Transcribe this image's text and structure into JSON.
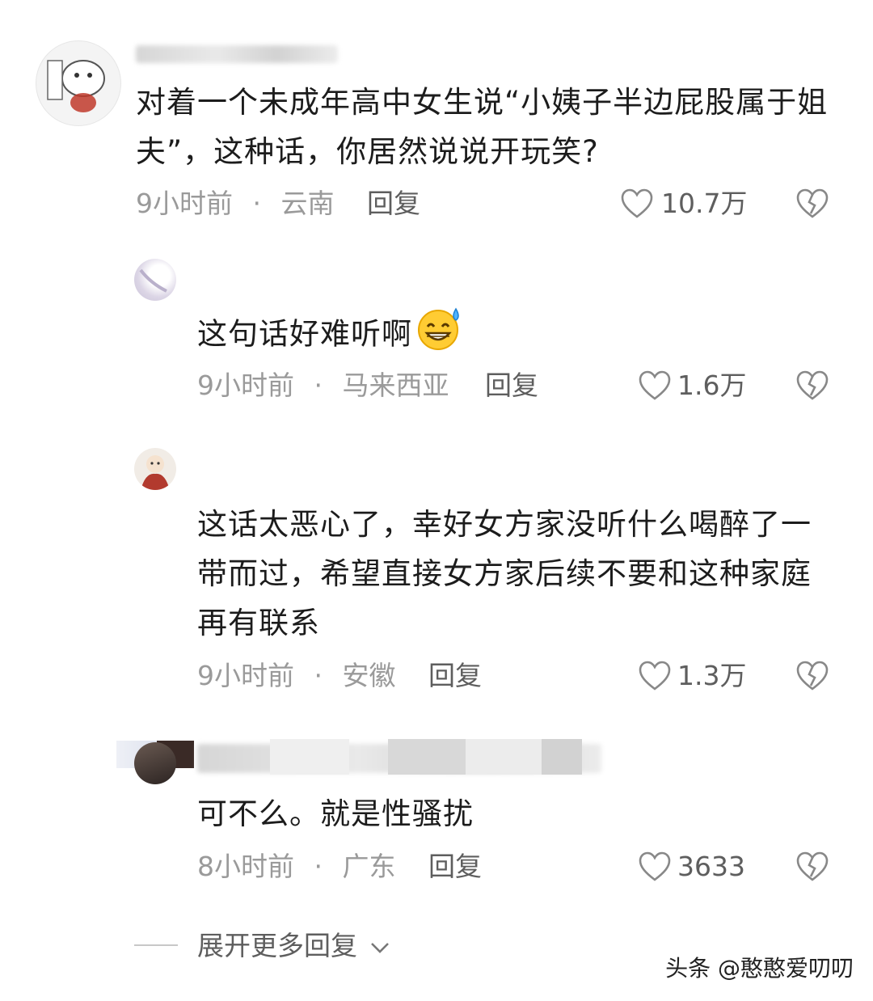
{
  "comments": [
    {
      "text": "对着一个未成年高中女生说“小姨子半边屁股属于姐夫”，这种话，你居然说说开玩笑?",
      "time": "9小时前",
      "location": "云南",
      "reply_label": "回复",
      "likes": "10.7万"
    },
    {
      "text": "这句话好难听啊",
      "emoji": "sweat-smile-emoji",
      "time": "9小时前",
      "location": "马来西亚",
      "reply_label": "回复",
      "likes": "1.6万"
    },
    {
      "text": "这话太恶心了，幸好女方家没听什么喝醉了一带而过，希望直接女方家后续不要和这种家庭再有联系",
      "time": "9小时前",
      "location": "安徽",
      "reply_label": "回复",
      "likes": "1.3万"
    },
    {
      "text": "可不么。就是性骚扰",
      "time": "8小时前",
      "location": "广东",
      "reply_label": "回复",
      "likes": "3633"
    }
  ],
  "separator": "·",
  "expand_more": "展开更多回复",
  "watermark": "头条 @憨憨爱叨叨",
  "icons": [
    "heart-outline-icon",
    "broken-heart-icon",
    "chevron-down-icon"
  ],
  "colors": {
    "meta": "#9a9a9a",
    "action": "#5e5e5e",
    "text": "#1c1c1c"
  }
}
